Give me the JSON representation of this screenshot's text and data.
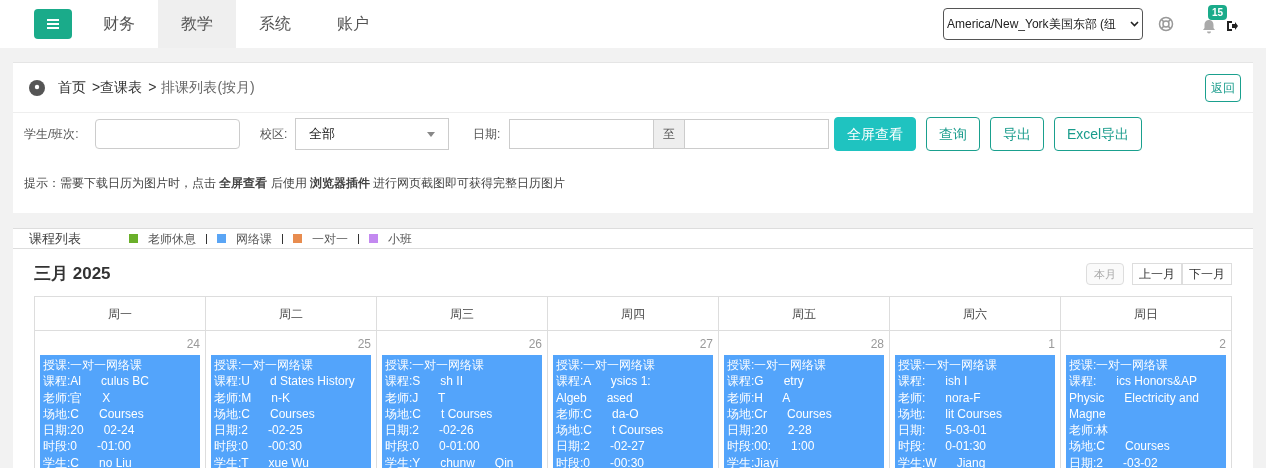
{
  "nav": {
    "tabs": [
      {
        "label": "财务",
        "selected": false
      },
      {
        "label": "教学",
        "selected": true
      },
      {
        "label": "系统",
        "selected": false
      },
      {
        "label": "账户",
        "selected": false
      }
    ],
    "timezone": "America/New_York美国东部 (纽",
    "notifications": "15"
  },
  "breadcrumb": {
    "items": [
      "首页",
      "查课表",
      "排课列表(按月)"
    ],
    "separator": ">",
    "back": "返回"
  },
  "filters": {
    "student_label": "学生/班次:",
    "campus_label": "校区:",
    "campus_value": "全部",
    "date_label": "日期:",
    "date_sep": "至",
    "buttons": [
      {
        "label": "全屏查看",
        "kind": "primary"
      },
      {
        "label": "查询",
        "kind": "outline"
      },
      {
        "label": "导出",
        "kind": "outline"
      },
      {
        "label": "Excel导出",
        "kind": "outline"
      }
    ]
  },
  "tip": "提示：需要下载日历为图片时，点击 **全屏查看** 后使用 **浏览器插件** 进行网页截图即可获得完整日历图片",
  "list": {
    "title": "课程列表",
    "legend": [
      {
        "label": "老师休息",
        "color": "#6aaf2a"
      },
      {
        "label": "网络课",
        "color": "#5aa5f5"
      },
      {
        "label": "一对一",
        "color": "#e88c4f"
      },
      {
        "label": "小班",
        "color": "#c389f0"
      }
    ]
  },
  "calendar": {
    "title": "三月 2025",
    "buttons": [
      {
        "label": "本月",
        "disabled": true
      },
      {
        "label": "上一月",
        "disabled": false
      },
      {
        "label": "下一月",
        "disabled": false
      }
    ],
    "weekdays": [
      "周一",
      "周二",
      "周三",
      "周四",
      "周五",
      "周六",
      "周日"
    ],
    "days": [
      {
        "number": "24",
        "lines": [
          "授课:一对一网络课",
          "课程:Al      culus BC",
          "老师:官      X",
          "场地:C      Courses",
          "日期:20      02-24",
          "时段:0      -01:00",
          "学生:C      no Liu"
        ]
      },
      {
        "number": "25",
        "lines": [
          "授课:一对一网络课",
          "课程:U      d States History",
          "老师:M      n-K",
          "场地:C      Courses",
          "日期:2      -02-25",
          "时段:0      -00:30",
          "学生:T      xue Wu"
        ]
      },
      {
        "number": "26",
        "lines": [
          "授课:一对一网络课",
          "课程:S      sh II",
          "老师:J      T",
          "场地:C      t Courses",
          "日期:2      -02-26",
          "时段:0      0-01:00",
          "学生:Y      chunw      Qin"
        ]
      },
      {
        "number": "27",
        "lines": [
          "授课:一对一网络课",
          "课程:A      ysics 1:",
          "Algeb      ased",
          "老师:C      da-O",
          "场地:C      t Courses",
          "日期:2      -02-27",
          "时段:0      -00:30"
        ]
      },
      {
        "number": "28",
        "lines": [
          "授课:一对一网络课",
          "课程:G      etry",
          "老师:H      A",
          "场地:Cr      Courses",
          "日期:20      2-28",
          "时段:00:      1:00",
          "学生:Jiayi"
        ]
      },
      {
        "number": "1",
        "lines": [
          "授课:一对一网络课",
          "课程:      ish I",
          "老师:      nora-F",
          "场地:      lit Courses",
          "日期:      5-03-01",
          "时段:      0-01:30",
          "学生:W      Jiang"
        ]
      },
      {
        "number": "2",
        "lines": [
          "授课:一对一网络课",
          "课程:      ics Honors&AP",
          "Physic      Electricity and",
          "Magne",
          "老师:林",
          "场地:C      Courses",
          "日期:2      -03-02"
        ]
      }
    ]
  }
}
